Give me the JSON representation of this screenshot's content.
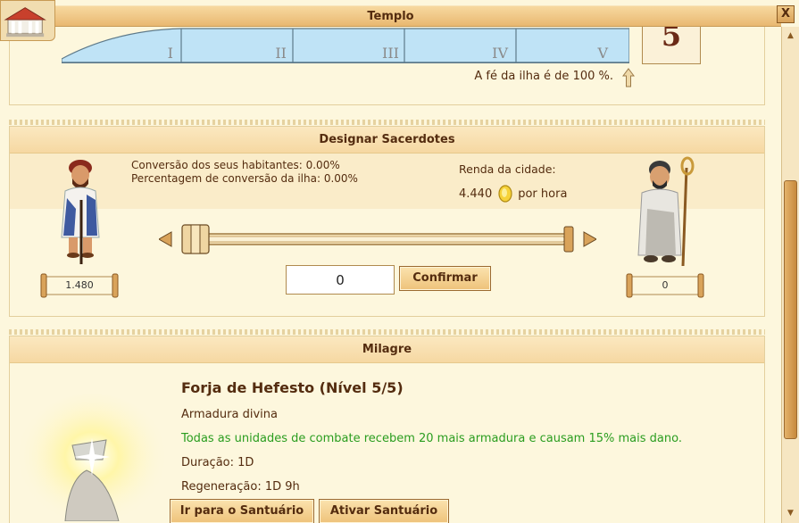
{
  "window": {
    "title": "Templo",
    "close_label": "X"
  },
  "faith": {
    "levels": [
      "I",
      "II",
      "III",
      "IV",
      "V"
    ],
    "island_faith_text": "A fé da ilha é de 100 %.",
    "temple_level": "5"
  },
  "priests": {
    "title": "Designar Sacerdotes",
    "conversion_citizens": "Conversão dos seus habitantes: 0.00%",
    "conversion_island": "Percentagem de conversão da ilha: 0.00%",
    "income_label": "Renda da cidade:",
    "income_value": "4.440",
    "income_unit": "por hora",
    "citizens_count": "1.480",
    "priests_count": "0",
    "slider_fraction": 0,
    "amount_value": "0",
    "confirm_label": "Confirmar"
  },
  "miracle": {
    "title": "Milagre",
    "name": "Forja de Hefesto (Nível 5/5)",
    "subtitle": "Armadura divina",
    "effect": "Todas as unidades de combate recebem 20 mais armadura e causam 15% mais dano.",
    "duration": "Duração: 1D",
    "regeneration": "Regeneração: 1D 9h",
    "goto_sanctuary_label": "Ir para o Santuário",
    "activate_sanctuary_label": "Ativar Santuário"
  },
  "colors": {
    "background": "#fdf7dd",
    "text": "#542c0f",
    "effect_green": "#2a9d1f",
    "bar_blue": "#bfe3f6"
  }
}
